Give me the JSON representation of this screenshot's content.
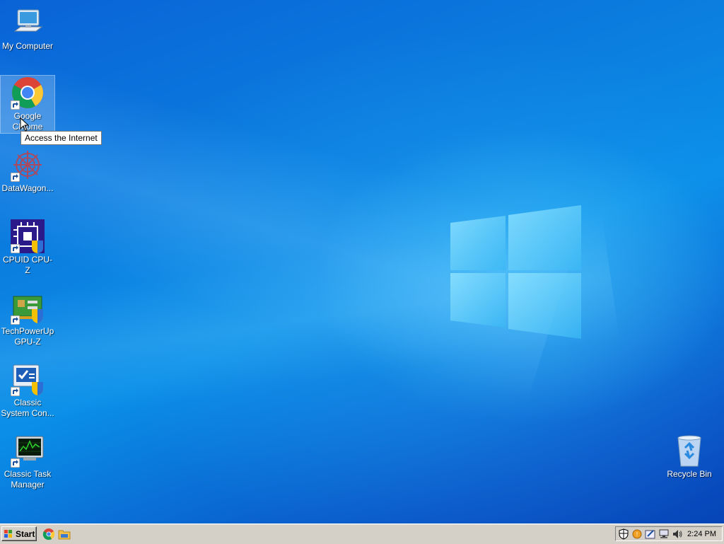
{
  "desktop": {
    "icons": [
      {
        "name": "my-computer-icon",
        "label": "My Computer"
      },
      {
        "name": "google-chrome-icon",
        "label": "Google Chrome",
        "selected": true
      },
      {
        "name": "datawagon-icon",
        "label": "DataWagon..."
      },
      {
        "name": "cpuid-cpu-z-icon",
        "label": "CPUID CPU-Z"
      },
      {
        "name": "techpowerup-gpu-z-icon",
        "label": "TechPowerUp GPU-Z"
      },
      {
        "name": "classic-system-control-icon",
        "label": "Classic System Con..."
      },
      {
        "name": "classic-task-manager-icon",
        "label": "Classic Task Manager"
      },
      {
        "name": "recycle-bin-icon",
        "label": "Recycle Bin"
      }
    ],
    "tooltip": "Access the Internet"
  },
  "taskbar": {
    "start_label": "Start",
    "quick_launch": [
      "chrome-icon",
      "file-explorer-icon"
    ],
    "tray_icons": [
      "security-shield-icon",
      "update-icon",
      "pen-icon",
      "network-icon",
      "volume-icon"
    ],
    "clock": "2:24 PM"
  },
  "colors": {
    "desktop_blue": "#0a7fe0",
    "taskbar_gray": "#d4d0c8"
  }
}
